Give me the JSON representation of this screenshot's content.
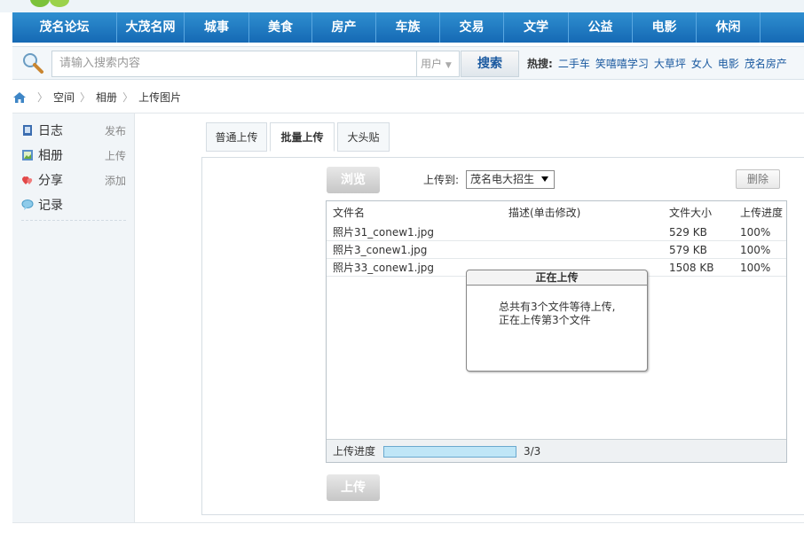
{
  "nav": {
    "items": [
      "茂名论坛",
      "大茂名网",
      "城事",
      "美食",
      "房产",
      "车族",
      "交易",
      "文学",
      "公益",
      "电影",
      "休闲"
    ]
  },
  "search": {
    "placeholder": "请输入搜索内容",
    "scope": "用户",
    "button": "搜索",
    "hot_label": "热搜:",
    "hot_links": [
      "二手车",
      "笑嘻嘻学习",
      "大草坪",
      "女人",
      "电影",
      "茂名房产"
    ]
  },
  "breadcrumb": [
    "空间",
    "相册",
    "上传图片"
  ],
  "sidebar": {
    "items": [
      {
        "label": "日志",
        "action": "发布",
        "icon": "blog-icon"
      },
      {
        "label": "相册",
        "action": "上传",
        "icon": "album-icon"
      },
      {
        "label": "分享",
        "action": "添加",
        "icon": "share-icon"
      },
      {
        "label": "记录",
        "action": "",
        "icon": "record-icon"
      }
    ]
  },
  "tabs": [
    {
      "label": "普通上传",
      "active": false
    },
    {
      "label": "批量上传",
      "active": true
    },
    {
      "label": "大头贴",
      "active": false
    }
  ],
  "uploader": {
    "browse": "浏览",
    "upload_to_label": "上传到:",
    "album": "茂名电大招生",
    "delete": "删除",
    "upload": "上传",
    "columns": [
      "文件名",
      "描述(单击修改)",
      "文件大小",
      "上传进度"
    ],
    "files": [
      {
        "name": "照片31_conew1.jpg",
        "desc": "",
        "size": "529 KB",
        "progress": "100%"
      },
      {
        "name": "照片3_conew1.jpg",
        "desc": "",
        "size": "579 KB",
        "progress": "100%"
      },
      {
        "name": "照片33_conew1.jpg",
        "desc": "",
        "size": "1508 KB",
        "progress": "100%"
      }
    ],
    "progress_label": "上传进度",
    "progress_fraction": 1.0,
    "progress_count": "3/3"
  },
  "dialog": {
    "title": "正在上传",
    "line1": "总共有3个文件等待上传,",
    "line2": "正在上传第3个文件"
  },
  "colors": {
    "nav": "#1f7cc4",
    "link": "#1b5aa0",
    "progress": "#bfe6f7"
  }
}
